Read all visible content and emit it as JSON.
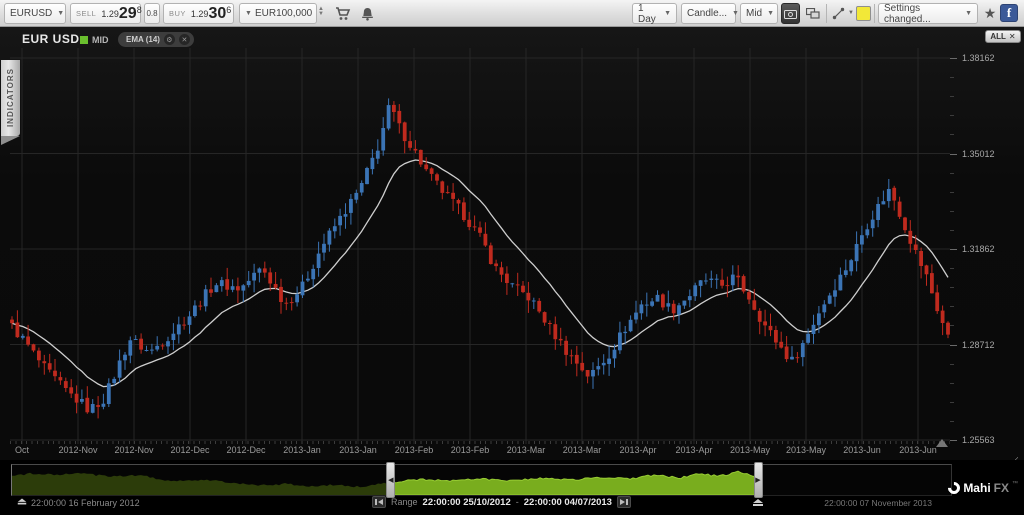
{
  "toolbar": {
    "symbol": "EURUSD",
    "sell": {
      "label": "SELL",
      "small": "1.29",
      "big": "29",
      "sup": "8"
    },
    "spread": "0.8",
    "buy": {
      "label": "BUY",
      "small": "1.29",
      "big": "30",
      "sup": "6"
    },
    "currency": "EUR",
    "amount": "100,000",
    "timeframe": "1 Day",
    "chart_type": "Candle...",
    "price_mode": "Mid",
    "settings": "Settings changed...",
    "star_glyph": "★",
    "facebook_glyph": "f",
    "caret_glyph": "▼"
  },
  "sidebar": {
    "indicators_label": "INDICATORS"
  },
  "chart_header": {
    "title": "EUR USD",
    "mid_label": "MID",
    "ema_label": "EMA (14)",
    "gear_glyph": "⚙",
    "close_glyph": "✕",
    "all_label": "ALL",
    "all_close_glyph": "✕"
  },
  "footer": {
    "start_date": "22:00:00 16 February 2012",
    "range_label": "Range",
    "range_start": "22:00:00 25/10/2012",
    "range_sep": "-",
    "range_end": "22:00:00 04/07/2013",
    "end_date": "22:00:00 07 November 2013",
    "logo_main": "Mahi",
    "logo_sub": "FX",
    "logo_tm": "™"
  },
  "chart_data": {
    "type": "candlestick",
    "symbol": "EUR/USD",
    "timeframe": "1 Day",
    "price_source": "Mid",
    "overlay": {
      "type": "EMA",
      "period": 14
    },
    "visible_range": {
      "start": "22:00:00 25/10/2012",
      "end": "22:00:00 04/07/2013"
    },
    "y_axis": {
      "labels": [
        1.38162,
        1.35012,
        1.31862,
        1.28712,
        1.25563
      ],
      "minor_per_gap": 4
    },
    "x_labels": [
      "Oct",
      "2012-Nov",
      "2012-Nov",
      "2012-Dec",
      "2012-Dec",
      "2013-Jan",
      "2013-Jan",
      "2013-Feb",
      "2013-Feb",
      "2013-Mar",
      "2013-Mar",
      "2013-Apr",
      "2013-Apr",
      "2013-May",
      "2013-May",
      "2013-Jun",
      "2013-Jun"
    ],
    "candle_count": 175,
    "price_path": [
      [
        0,
        1.293
      ],
      [
        0.014,
        1.288
      ],
      [
        0.035,
        1.279
      ],
      [
        0.057,
        1.272
      ],
      [
        0.083,
        1.2655
      ],
      [
        0.099,
        1.2695
      ],
      [
        0.126,
        1.289
      ],
      [
        0.147,
        1.2845
      ],
      [
        0.171,
        1.291
      ],
      [
        0.19,
        1.297
      ],
      [
        0.217,
        1.3075
      ],
      [
        0.244,
        1.3055
      ],
      [
        0.267,
        1.3125
      ],
      [
        0.292,
        1.3005
      ],
      [
        0.31,
        1.306
      ],
      [
        0.331,
        1.3195
      ],
      [
        0.35,
        1.3285
      ],
      [
        0.372,
        1.3385
      ],
      [
        0.391,
        1.3525
      ],
      [
        0.404,
        1.3665
      ],
      [
        0.412,
        1.3595
      ],
      [
        0.427,
        1.3525
      ],
      [
        0.444,
        1.3435
      ],
      [
        0.466,
        1.3355
      ],
      [
        0.484,
        1.3295
      ],
      [
        0.502,
        1.3215
      ],
      [
        0.516,
        1.3125
      ],
      [
        0.534,
        1.3065
      ],
      [
        0.553,
        1.3025
      ],
      [
        0.573,
        1.2935
      ],
      [
        0.591,
        1.2855
      ],
      [
        0.617,
        1.2765
      ],
      [
        0.637,
        1.2835
      ],
      [
        0.655,
        1.2925
      ],
      [
        0.673,
        1.3005
      ],
      [
        0.69,
        1.3025
      ],
      [
        0.705,
        1.2985
      ],
      [
        0.724,
        1.3035
      ],
      [
        0.74,
        1.3085
      ],
      [
        0.758,
        1.3065
      ],
      [
        0.772,
        1.3095
      ],
      [
        0.788,
        1.3025
      ],
      [
        0.804,
        1.2935
      ],
      [
        0.823,
        1.2855
      ],
      [
        0.833,
        1.2815
      ],
      [
        0.847,
        1.2885
      ],
      [
        0.863,
        1.2985
      ],
      [
        0.879,
        1.3065
      ],
      [
        0.895,
        1.3145
      ],
      [
        0.911,
        1.3255
      ],
      [
        0.927,
        1.3335
      ],
      [
        0.938,
        1.3385
      ],
      [
        0.951,
        1.3285
      ],
      [
        0.964,
        1.3185
      ],
      [
        0.977,
        1.3095
      ],
      [
        0.989,
        1.2985
      ],
      [
        1,
        1.2895
      ]
    ],
    "colors": {
      "up": "#3b74b5",
      "down": "#bf2a1e",
      "ema": "#d9d9d9",
      "grid": "#262626",
      "overview_dim": "#2c3c0a",
      "overview_bright": "#79ad1e",
      "overview_edge": "#97cc33"
    },
    "overview": {
      "full_range": {
        "start": "16 February 2012",
        "end": "07 November 2013"
      },
      "selection": [
        0.405,
        0.795
      ],
      "points": [
        [
          0,
          0.69
        ],
        [
          0.02,
          0.81
        ],
        [
          0.047,
          0.75
        ],
        [
          0.073,
          0.81
        ],
        [
          0.105,
          0.69
        ],
        [
          0.137,
          0.75
        ],
        [
          0.158,
          0.56
        ],
        [
          0.185,
          0.5
        ],
        [
          0.211,
          0.53
        ],
        [
          0.238,
          0.41
        ],
        [
          0.265,
          0.31
        ],
        [
          0.291,
          0.38
        ],
        [
          0.318,
          0.28
        ],
        [
          0.344,
          0.34
        ],
        [
          0.371,
          0.25
        ],
        [
          0.405,
          0.44
        ],
        [
          0.435,
          0.56
        ],
        [
          0.466,
          0.5
        ],
        [
          0.498,
          0.59
        ],
        [
          0.53,
          0.5
        ],
        [
          0.562,
          0.62
        ],
        [
          0.594,
          0.53
        ],
        [
          0.626,
          0.66
        ],
        [
          0.658,
          0.59
        ],
        [
          0.684,
          0.75
        ],
        [
          0.711,
          0.62
        ],
        [
          0.732,
          0.81
        ],
        [
          0.753,
          0.69
        ],
        [
          0.774,
          0.88
        ],
        [
          0.795,
          0.66
        ]
      ]
    }
  }
}
